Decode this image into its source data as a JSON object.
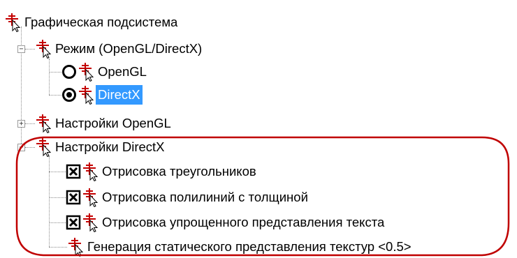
{
  "tree": {
    "root": {
      "label": "Графическая подсистема",
      "icon": "cursor-target-icon"
    },
    "mode": {
      "label": "Режим (OpenGL/DirectX)",
      "expander": "−",
      "options": [
        {
          "label": "OpenGL",
          "state": "unselected"
        },
        {
          "label": "DirectX",
          "state": "selected"
        }
      ]
    },
    "opengl_settings": {
      "label": "Настройки OpenGL",
      "expander": "+"
    },
    "directx_settings": {
      "label": "Настройки DirectX",
      "expander": "−",
      "items": [
        {
          "label": "Отрисовка треугольников",
          "checked": true
        },
        {
          "label": "Отрисовка полилиний с толщиной",
          "checked": true
        },
        {
          "label": "Отрисовка упрощенного представления текста",
          "checked": true
        },
        {
          "label": "Генерация статического представления текстур <0.5>"
        }
      ]
    }
  },
  "colors": {
    "selection": "#3399ff",
    "annotation": "#c00000",
    "icon": "#cc0000"
  }
}
